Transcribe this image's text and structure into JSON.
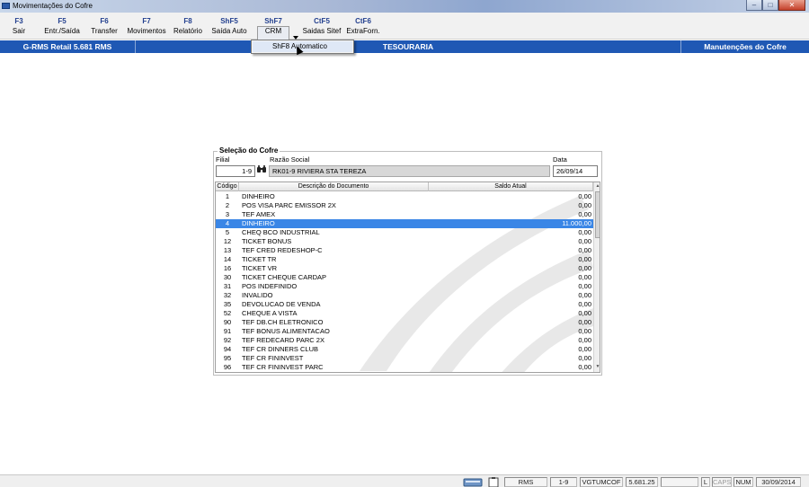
{
  "window": {
    "title": "Movimentações do Cofre",
    "controls": [
      "minimize-icon",
      "maximize-icon",
      "close-icon"
    ]
  },
  "toolbar": {
    "buttons": [
      {
        "key": "F3",
        "label": "Sair"
      },
      {
        "key": "F5",
        "label": "Entr./Saída"
      },
      {
        "key": "F6",
        "label": "Transfer"
      },
      {
        "key": "F7",
        "label": "Movimentos"
      },
      {
        "key": "F8",
        "label": "Relatório"
      },
      {
        "key": "ShF5",
        "label": "Saída Auto"
      },
      {
        "key": "ShF7",
        "label": "CRM"
      },
      {
        "key": "CtF5",
        "label": "Saidas Sitef"
      },
      {
        "key": "CtF6",
        "label": "ExtraForn."
      }
    ]
  },
  "dropdown": {
    "item": "ShF8  Automatico"
  },
  "infobar": {
    "system": "G-RMS Retail 5.681 RMS",
    "module": "TESOURARIA",
    "screen": "Manutenções do Cofre"
  },
  "selection": {
    "title": "Seleção do Cofre",
    "filial_label": "Filial",
    "filial_value": "1-9",
    "razao_label": "Razão Social",
    "razao_value": "RK01-9 RIVIERA STA TEREZA",
    "data_label": "Data",
    "data_value": "26/09/14"
  },
  "grid": {
    "columns": [
      "Código",
      "Descrição do Documento",
      "Saldo Atual"
    ],
    "rows": [
      {
        "codigo": "1",
        "descricao": "DINHEIRO",
        "saldo": "0,00"
      },
      {
        "codigo": "2",
        "descricao": "POS VISA PARC EMISSOR  2X",
        "saldo": "0,00"
      },
      {
        "codigo": "3",
        "descricao": "TEF AMEX",
        "saldo": "0,00"
      },
      {
        "codigo": "4",
        "descricao": "DINHEIRO",
        "saldo": "11.000,00"
      },
      {
        "codigo": "5",
        "descricao": "CHEQ BCO INDUSTRIAL",
        "saldo": "0,00"
      },
      {
        "codigo": "12",
        "descricao": "TICKET BONUS",
        "saldo": "0,00"
      },
      {
        "codigo": "13",
        "descricao": "TEF CRED REDESHOP-C",
        "saldo": "0,00"
      },
      {
        "codigo": "14",
        "descricao": "TICKET TR",
        "saldo": "0,00"
      },
      {
        "codigo": "16",
        "descricao": "TICKET VR",
        "saldo": "0,00"
      },
      {
        "codigo": "30",
        "descricao": "TICKET CHEQUE CARDAP",
        "saldo": "0,00"
      },
      {
        "codigo": "31",
        "descricao": "POS INDEFINIDO",
        "saldo": "0,00"
      },
      {
        "codigo": "32",
        "descricao": "INVALIDO",
        "saldo": "0,00"
      },
      {
        "codigo": "35",
        "descricao": "DEVOLUCAO DE VENDA",
        "saldo": "0,00"
      },
      {
        "codigo": "52",
        "descricao": "CHEQUE A VISTA",
        "saldo": "0,00"
      },
      {
        "codigo": "90",
        "descricao": "TEF DB.CH ELETRONICO",
        "saldo": "0,00"
      },
      {
        "codigo": "91",
        "descricao": "TEF BONUS ALIMENTACAO",
        "saldo": "0,00"
      },
      {
        "codigo": "92",
        "descricao": "TEF REDECARD PARC 2X",
        "saldo": "0,00"
      },
      {
        "codigo": "94",
        "descricao": "TEF CR DINNERS CLUB",
        "saldo": "0,00"
      },
      {
        "codigo": "95",
        "descricao": "TEF CR FININVEST",
        "saldo": "0,00"
      },
      {
        "codigo": "96",
        "descricao": "TEF CR FININVEST PARC",
        "saldo": "0,00"
      }
    ],
    "selected_codigo": "4"
  },
  "statusbar": {
    "app": "RMS",
    "filial": "1-9",
    "program": "VGTUMCOF",
    "version": "5.681.25",
    "blank": "",
    "indicators": [
      "L",
      "CAPS",
      "NUM"
    ],
    "date": "30/09/2014"
  },
  "colors": {
    "infobar": "#1f58b4",
    "selection": "#3a86e6",
    "toolbar_key": "#23408f"
  }
}
